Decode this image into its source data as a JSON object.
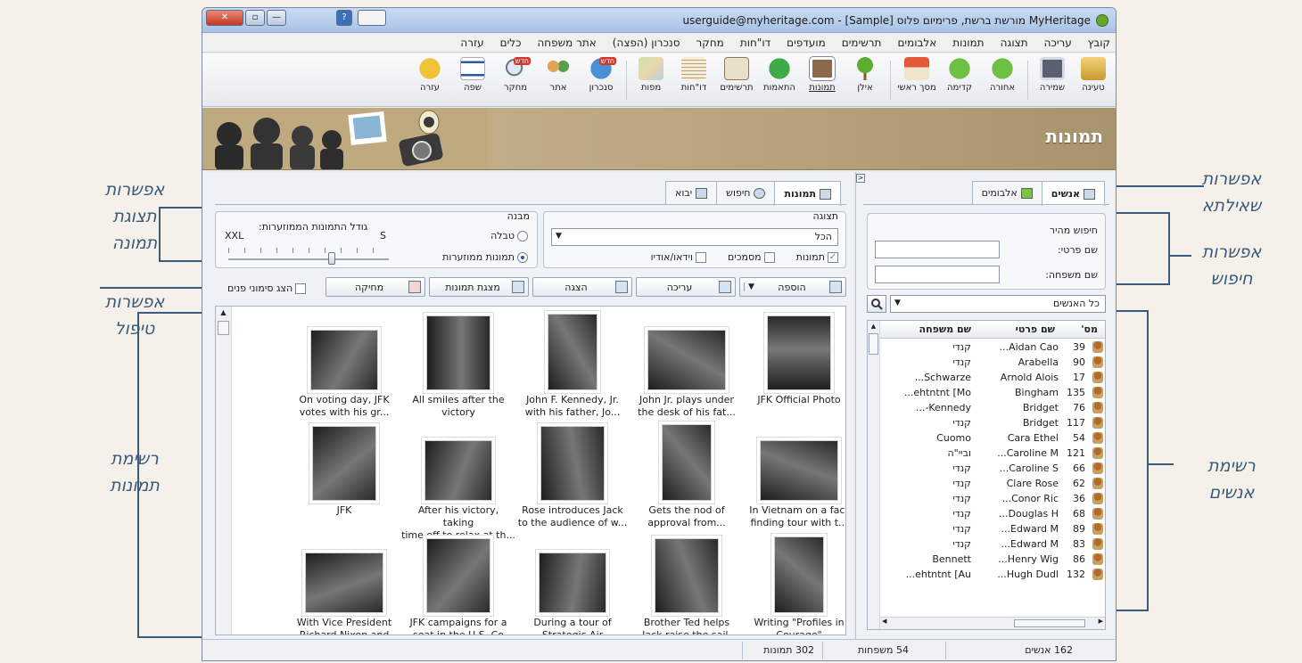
{
  "window": {
    "title": "MyHeritage מורשת ברשת, פרימיום פלוס [Sample] - userguide@myheritage.com",
    "minimize": "—",
    "maximize": "▫",
    "close": "✕"
  },
  "menu": [
    "קובץ",
    "עריכה",
    "תצוגה",
    "תמונות",
    "אלבומים",
    "תרשימים",
    "מועדפים",
    "דו\"חות",
    "מחקר",
    "סנכרון (הפצה)",
    "אתר משפחה",
    "כלים",
    "עזרה"
  ],
  "toolbar": {
    "items": [
      {
        "label": "טעינה",
        "icon": "folder-open-icon"
      },
      {
        "label": "שמירה",
        "icon": "save-icon"
      },
      {
        "label": "אחורה",
        "icon": "arrow-back-icon"
      },
      {
        "label": "קדימה",
        "icon": "arrow-forward-icon"
      },
      {
        "label": "מסך ראשי",
        "icon": "home-icon"
      },
      {
        "label": "אילן",
        "icon": "tree-icon"
      },
      {
        "label": "תמונות",
        "icon": "photos-icon"
      },
      {
        "label": "התאמות",
        "icon": "matches-icon"
      },
      {
        "label": "תרשימים",
        "icon": "charts-icon"
      },
      {
        "label": "דו\"חות",
        "icon": "reports-icon"
      },
      {
        "label": "מפות",
        "icon": "map-icon"
      },
      {
        "label": "סנכרון",
        "icon": "sync-icon"
      },
      {
        "label": "אתר",
        "icon": "family-site-icon"
      },
      {
        "label": "מחקר",
        "icon": "research-icon"
      },
      {
        "label": "שפה",
        "icon": "language-flag-icon"
      },
      {
        "label": "עזרה",
        "icon": "help-icon"
      }
    ],
    "new_badge": "חדש"
  },
  "banner": {
    "title": "תמונות"
  },
  "left_tabs": [
    "תמונות",
    "חיפוש",
    "יבוא"
  ],
  "view_group": {
    "label": "תצוגה",
    "filter_value": "הכל",
    "checkboxes": [
      {
        "label": "תמונות",
        "checked": true
      },
      {
        "label": "מסמכים",
        "checked": false
      },
      {
        "label": "וידאו/אודיו",
        "checked": false
      }
    ]
  },
  "structure_group": {
    "label": "מבנה",
    "options": [
      {
        "label": "טבלה",
        "selected": false
      },
      {
        "label": "תמונות ממוזערות",
        "selected": true
      }
    ],
    "thumb_size_label": "גודל התמונות הממוזערות:",
    "size_min": "S",
    "size_max": "XXL",
    "size_value": 0.35
  },
  "actions": [
    "הוספה",
    "עריכה",
    "הצגה",
    "מצגת תמונות",
    "מחיקה"
  ],
  "show_faces": "הצג סימוני פנים",
  "photos": [
    [
      "JFK Official Photo",
      "John Jr. plays under|the desk of his fat...",
      "John F. Kennedy, Jr.|with his father, Jo...",
      "All smiles after the|victory",
      "On voting day, JFK|votes with his gr..."
    ],
    [
      "In Vietnam on a fact|finding tour with t...",
      "Gets the nod of|approval from...",
      "Rose introduces Jack|to the audience of w...",
      "After his victory, taking|time off to relax at th...",
      "JFK"
    ],
    [
      "Writing \"Profiles in|Courage\"",
      "Brother Ted helps|Jack raise the sail.",
      "During a tour of|Strategic Air",
      "JFK campaigns for a|seat in the U.S. Co",
      "With Vice President|Richard Nixon and"
    ]
  ],
  "right_tabs": [
    "אנשים",
    "אלבומים"
  ],
  "quick_search": {
    "label": "חיפוש מהיר",
    "first_name_label": "שם פרטי:",
    "last_name_label": "שם משפחה:",
    "first_name_value": "",
    "last_name_value": ""
  },
  "people_filter": "כל האנשים",
  "people_columns": [
    "מס'",
    "שם פרטי",
    "שם משפחה"
  ],
  "people": [
    [
      "39",
      "Aidan Cao...",
      "קנדי"
    ],
    [
      "90",
      "Arabella",
      "קנדי"
    ],
    [
      "17",
      "Arnold Alois",
      "Schwarze..."
    ],
    [
      "135",
      "Bingham",
      "ehtntnt [Mo..."
    ],
    [
      "76",
      "Bridget",
      "Kennedy-..."
    ],
    [
      "117",
      "Bridget",
      "קנדי"
    ],
    [
      "54",
      "Cara Ethel",
      "Cuomo"
    ],
    [
      "121",
      "Caroline M...",
      "וביי\"ה"
    ],
    [
      "66",
      "Caroline S...",
      "קנדי"
    ],
    [
      "62",
      "Clare Rose",
      "קנדי"
    ],
    [
      "36",
      "Conor Ric...",
      "קנדי"
    ],
    [
      "68",
      "Douglas H...",
      "קנדי"
    ],
    [
      "89",
      "Edward M...",
      "קנדי"
    ],
    [
      "83",
      "Edward M...",
      "קנדי"
    ],
    [
      "86",
      "Henry Wig...",
      "Bennett"
    ],
    [
      "132",
      "Hugh Dudl...",
      "ehtntnt [Au..."
    ]
  ],
  "status": {
    "people": "162 אנשים",
    "families": "54 משפחות",
    "photos": "302 תמונות"
  },
  "callouts": {
    "view_options": [
      "אפשרות",
      "תצוגת",
      "תמונה"
    ],
    "actions": [
      "אפשרות",
      "טיפול"
    ],
    "photo_list": [
      "רשימת",
      "תמונות"
    ],
    "query": [
      "אפשרות",
      "שאילתא"
    ],
    "search": [
      "אפשרות",
      "חיפוש"
    ],
    "people_list": [
      "רשימת",
      "אנשים"
    ]
  },
  "colors": {
    "accent": "#2a5aa8",
    "leader": "#3c5b7a",
    "titlebar": "#b9cfec",
    "banner": "#b8a47c"
  }
}
